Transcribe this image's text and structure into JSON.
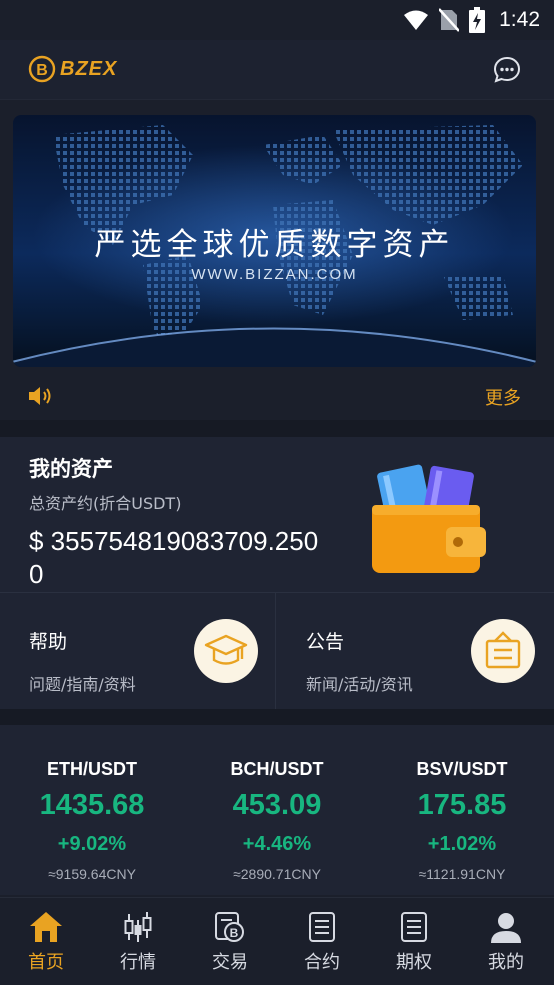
{
  "status_bar": {
    "time": "1:42"
  },
  "header": {
    "brand": "BZEX"
  },
  "banner": {
    "title": "严选全球优质数字资产",
    "url": "WWW.BIZZAN.COM"
  },
  "notice": {
    "more_label": "更多"
  },
  "assets": {
    "title": "我的资产",
    "subtitle": "总资产约(折合USDT)",
    "value": "$ 355754819083709.2500"
  },
  "cards": {
    "help": {
      "title": "帮助",
      "subtitle": "问题/指南/资料"
    },
    "announce": {
      "title": "公告",
      "subtitle": "新闻/活动/资讯"
    }
  },
  "tickers": [
    {
      "pair": "ETH/USDT",
      "price": "1435.68",
      "change": "+9.02%",
      "cny": "≈9159.64CNY"
    },
    {
      "pair": "BCH/USDT",
      "price": "453.09",
      "change": "+4.46%",
      "cny": "≈2890.71CNY"
    },
    {
      "pair": "BSV/USDT",
      "price": "175.85",
      "change": "+1.02%",
      "cny": "≈1121.91CNY"
    }
  ],
  "tabs": [
    {
      "label": "首页",
      "icon": "home-icon",
      "active": true
    },
    {
      "label": "行情",
      "icon": "candlestick-icon",
      "active": false
    },
    {
      "label": "交易",
      "icon": "exchange-icon",
      "active": false
    },
    {
      "label": "合约",
      "icon": "document-icon",
      "active": false
    },
    {
      "label": "期权",
      "icon": "document-icon",
      "active": false
    },
    {
      "label": "我的",
      "icon": "user-icon",
      "active": false
    }
  ],
  "colors": {
    "accent": "#e9a322",
    "up": "#18b680",
    "background": "#1b1f2b",
    "panel": "#1f2433"
  }
}
